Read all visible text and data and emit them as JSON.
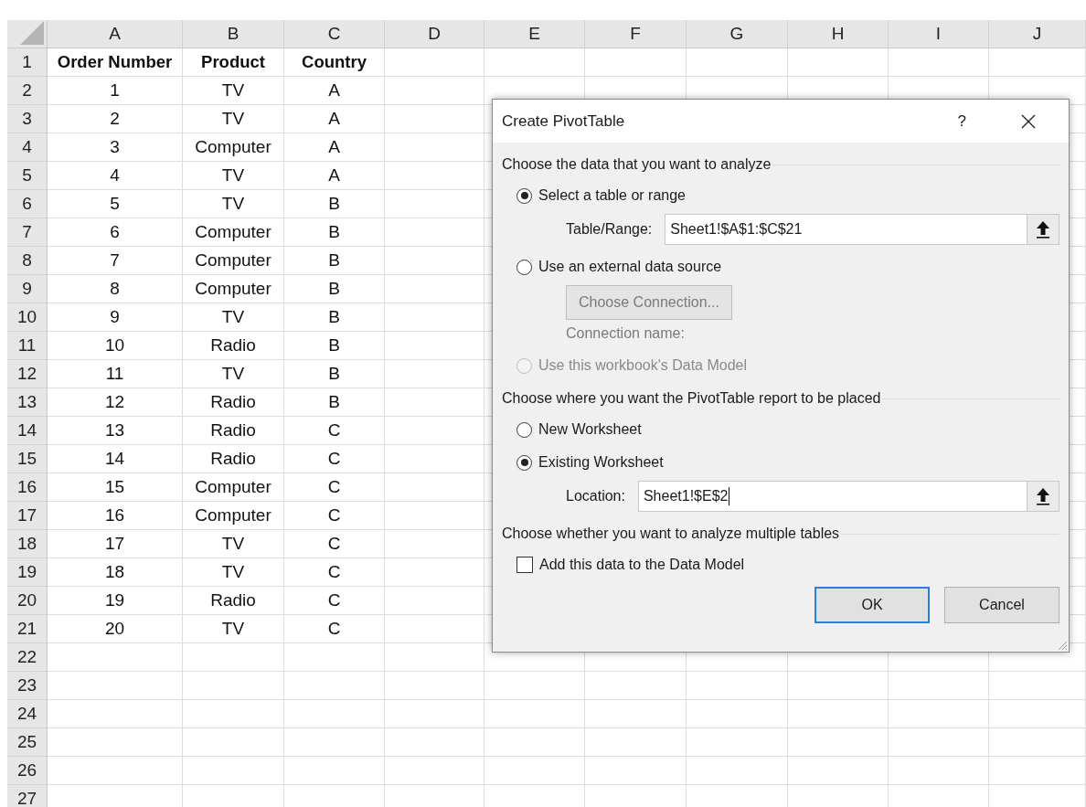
{
  "sheet": {
    "columns": [
      "A",
      "B",
      "C",
      "D",
      "E",
      "F",
      "G",
      "H",
      "I",
      "J"
    ],
    "rows": [
      {
        "number": "1",
        "kind": "header",
        "cells": [
          "Order Number",
          "Product",
          "Country"
        ]
      },
      {
        "number": "2",
        "kind": "data",
        "cells": [
          "1",
          "TV",
          "A"
        ]
      },
      {
        "number": "3",
        "kind": "data",
        "cells": [
          "2",
          "TV",
          "A"
        ]
      },
      {
        "number": "4",
        "kind": "data",
        "cells": [
          "3",
          "Computer",
          "A"
        ]
      },
      {
        "number": "5",
        "kind": "data",
        "cells": [
          "4",
          "TV",
          "A"
        ]
      },
      {
        "number": "6",
        "kind": "data",
        "cells": [
          "5",
          "TV",
          "B"
        ]
      },
      {
        "number": "7",
        "kind": "data",
        "cells": [
          "6",
          "Computer",
          "B"
        ]
      },
      {
        "number": "8",
        "kind": "data",
        "cells": [
          "7",
          "Computer",
          "B"
        ]
      },
      {
        "number": "9",
        "kind": "data",
        "cells": [
          "8",
          "Computer",
          "B"
        ]
      },
      {
        "number": "10",
        "kind": "data",
        "cells": [
          "9",
          "TV",
          "B"
        ]
      },
      {
        "number": "11",
        "kind": "data",
        "cells": [
          "10",
          "Radio",
          "B"
        ]
      },
      {
        "number": "12",
        "kind": "data",
        "cells": [
          "11",
          "TV",
          "B"
        ]
      },
      {
        "number": "13",
        "kind": "data",
        "cells": [
          "12",
          "Radio",
          "B"
        ]
      },
      {
        "number": "14",
        "kind": "data",
        "cells": [
          "13",
          "Radio",
          "C"
        ]
      },
      {
        "number": "15",
        "kind": "data",
        "cells": [
          "14",
          "Radio",
          "C"
        ]
      },
      {
        "number": "16",
        "kind": "data",
        "cells": [
          "15",
          "Computer",
          "C"
        ]
      },
      {
        "number": "17",
        "kind": "data",
        "cells": [
          "16",
          "Computer",
          "C"
        ]
      },
      {
        "number": "18",
        "kind": "data",
        "cells": [
          "17",
          "TV",
          "C"
        ]
      },
      {
        "number": "19",
        "kind": "data",
        "cells": [
          "18",
          "TV",
          "C"
        ]
      },
      {
        "number": "20",
        "kind": "data",
        "cells": [
          "19",
          "Radio",
          "C"
        ]
      },
      {
        "number": "21",
        "kind": "data",
        "cells": [
          "20",
          "TV",
          "C"
        ]
      },
      {
        "number": "22",
        "kind": "data"
      },
      {
        "number": "23",
        "kind": "data"
      },
      {
        "number": "24",
        "kind": "data"
      },
      {
        "number": "25",
        "kind": "data"
      },
      {
        "number": "26",
        "kind": "data"
      },
      {
        "number": "27",
        "kind": "data"
      }
    ]
  },
  "dialog": {
    "title": "Create PivotTable",
    "help_button": "?",
    "sections": [
      {
        "heading": "Choose the data that you want to analyze",
        "items": [
          {
            "kind": "radio",
            "label": "Select a table or range",
            "selected": true,
            "disabled": false
          },
          {
            "kind": "range_field",
            "label": "Table/Range:",
            "value": "Sheet1!$A$1:$C$21",
            "focused": false
          },
          {
            "kind": "radio",
            "label": "Use an external data source",
            "selected": false,
            "disabled": false
          },
          {
            "kind": "button",
            "label": "Choose Connection...",
            "disabled": true
          },
          {
            "kind": "caption",
            "label": "Connection name:",
            "disabled": true
          },
          {
            "kind": "radio",
            "label": "Use this workbook's Data Model",
            "selected": false,
            "disabled": true
          }
        ]
      },
      {
        "heading": "Choose where you want the PivotTable report to be placed",
        "items": [
          {
            "kind": "radio",
            "label": "New Worksheet",
            "selected": false,
            "disabled": false
          },
          {
            "kind": "radio",
            "label": "Existing Worksheet",
            "selected": true,
            "disabled": false
          },
          {
            "kind": "range_field",
            "label": "Location:",
            "value": "Sheet1!$E$2",
            "focused": true
          }
        ]
      },
      {
        "heading": "Choose whether you want to analyze multiple tables",
        "items": [
          {
            "kind": "checkbox",
            "label": "Add this data to the Data Model",
            "checked": false
          }
        ]
      }
    ],
    "buttons": [
      {
        "label": "OK",
        "default": true
      },
      {
        "label": "Cancel",
        "default": false
      }
    ]
  }
}
